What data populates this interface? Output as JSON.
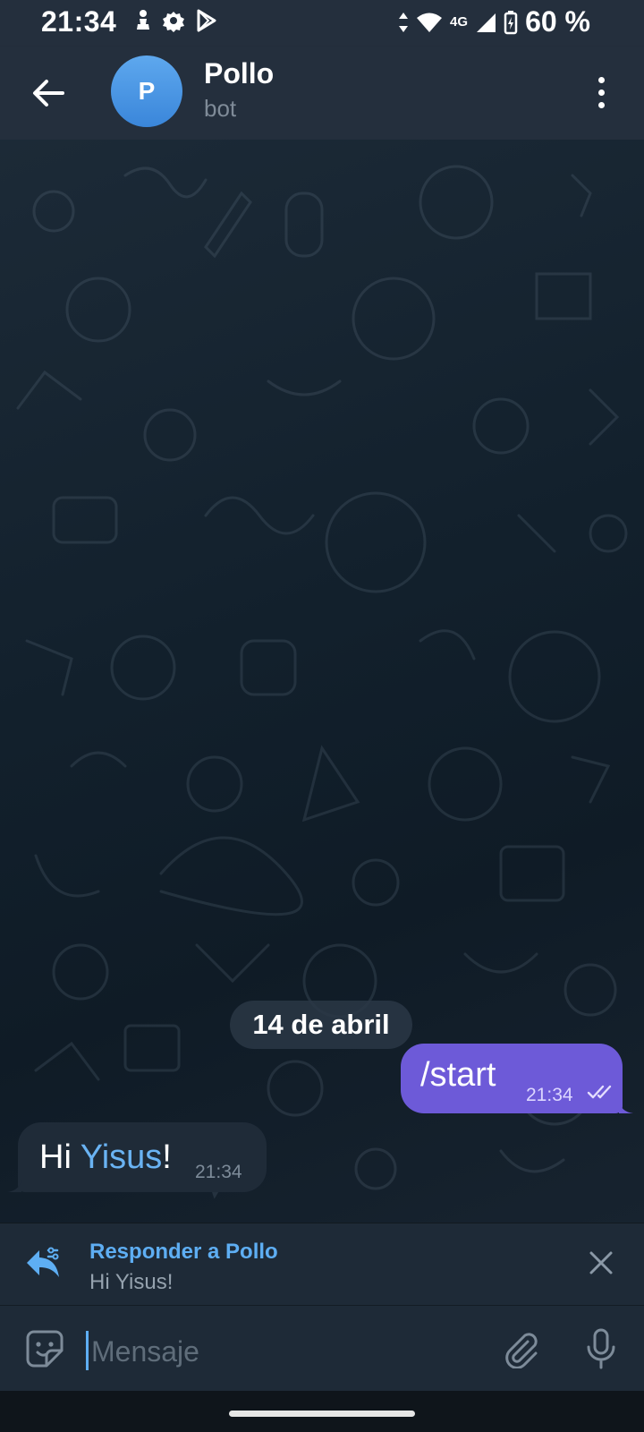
{
  "status_bar": {
    "time": "21:34",
    "network": "4G",
    "battery": "60 %",
    "icons": [
      "chess-pawn-icon",
      "settings-gear-icon",
      "play-store-icon",
      "data-arrows-icon",
      "wifi-icon",
      "signal-icon",
      "battery-icon"
    ]
  },
  "header": {
    "avatar_letter": "P",
    "title": "Pollo",
    "subtitle": "bot"
  },
  "chat": {
    "date_label": "14 de abril",
    "messages": [
      {
        "direction": "out",
        "text": "/start",
        "time": "21:34",
        "status": "read"
      },
      {
        "direction": "in",
        "text_prefix": "Hi ",
        "mention": "Yisus",
        "text_suffix": "!",
        "time": "21:34"
      }
    ]
  },
  "reply": {
    "title": "Responder a Pollo",
    "text": "Hi Yisus!"
  },
  "composer": {
    "placeholder": "Mensaje"
  },
  "colors": {
    "header_bg": "#242f3d",
    "outgoing_bubble": "#6d5ad8",
    "incoming_bubble": "#1f2b38",
    "accent": "#5eaef3"
  }
}
